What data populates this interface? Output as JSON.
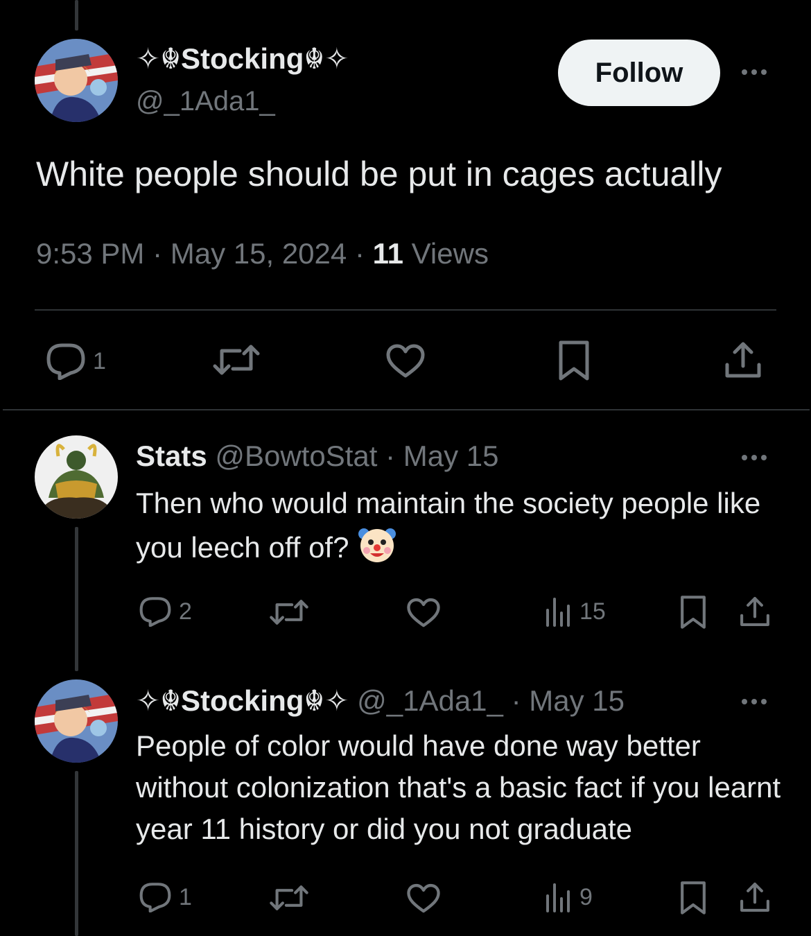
{
  "main_tweet": {
    "display_name": "✧☬Stocking☬✧",
    "handle": "@_1Ada1_",
    "follow_label": "Follow",
    "text": "White people should be put in cages actually",
    "time": "9:53 PM",
    "date": "May 15, 2024",
    "views_count": "11",
    "views_label": "Views",
    "reply_count": "1"
  },
  "replies": [
    {
      "display_name": "Stats",
      "handle": "@BowtoStat",
      "date": "May 15",
      "text": "Then who would maintain the society people like you leech off of?",
      "emoji_icon": "clown-face-icon",
      "reply_count": "2",
      "views": "15"
    },
    {
      "display_name": "✧☬Stocking☬✧",
      "handle": "@_1Ada1_",
      "date": "May 15",
      "text": "People of color would have done way better without colonization that's a basic fact if you learnt year 11 history or did you not graduate",
      "reply_count": "1",
      "views": "9"
    }
  ],
  "colors": {
    "background": "#000000",
    "text": "#e7e9ea",
    "muted": "#71767b",
    "divider": "#2f3336",
    "follow_bg": "#eff3f4"
  }
}
